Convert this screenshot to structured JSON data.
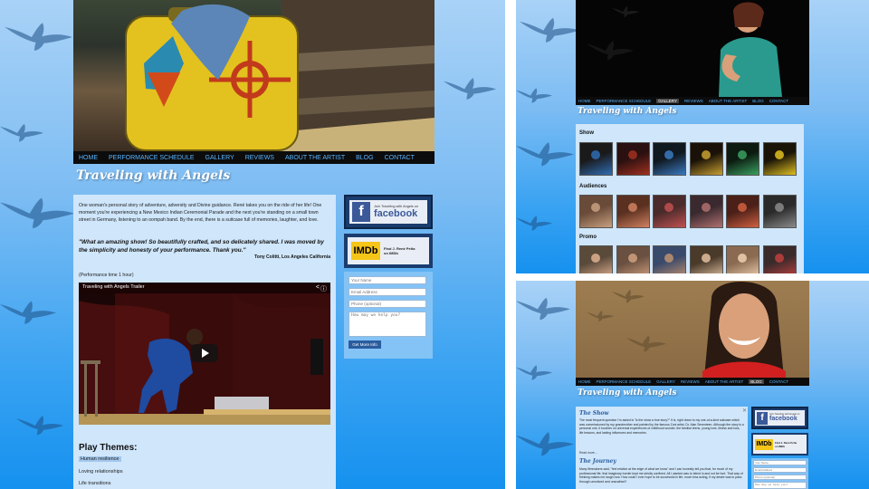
{
  "site": {
    "title": "Traveling with Angels"
  },
  "nav": [
    "HOME",
    "PERFORMANCE SCHEDULE",
    "GALLERY",
    "REVIEWS",
    "ABOUT THE ARTIST",
    "BLOG",
    "CONTACT"
  ],
  "home": {
    "intro": "One woman's personal story of adventure, adversity and Divine guidance. René takes you on the ride of her life! One moment you're experiencing a New Mexico Indian Ceremonial Parade and the next you're standing on a small town street in Germany, listening to an oompah band. By the end, there is a suitcase full of memories, laughter, and love.",
    "quote": "\"What an amazing show! So beautifully crafted, and so delicately shared. I was moved by the simplicity and honesty of your performance. Thank you.\"",
    "quote_author": "Tony Colitti, Los Angeles California",
    "performance_time": "(Performance time 1 hour)",
    "video_title": "Traveling with Angels Trailer",
    "themes_heading": "Play Themes:",
    "themes": [
      "Human resilience",
      "Loving relationships",
      "Life transitions"
    ]
  },
  "sidebar": {
    "facebook_small": "Join Traveling with Angels on",
    "facebook_big": "facebook",
    "imdb_logo": "IMDb",
    "imdb_line1": "Find J. René Peña",
    "imdb_line2": "on IMDb",
    "form": {
      "name_placeholder": "Your Name",
      "email_placeholder": "Email Address",
      "phone_placeholder": "Phone (optional)",
      "message_placeholder": "How may we help you?",
      "button": "Get More Info"
    }
  },
  "gallery": {
    "sections": [
      "Show",
      "Audiences",
      "Promo"
    ],
    "active_nav": "GALLERY"
  },
  "about": {
    "active_nav": "BLOG",
    "section1_title": "The Show",
    "section1_text": "The most frequent question I'm asked is \"is the show a true story?\" It is, right down to my one-of-a-kind suitcase which was commissioned by my grandmother and painted by the famous Zuni artist, Dr. Alan Seventeen. Although the story is a personal one, it touches on universal experiences of childhood wonder, the familiar teens, young love, illness and loss, life lessons, and lasting influences and memories.",
    "read_more": "Read more...",
    "section2_title": "The Journey",
    "section2_text": "Many filmmakers said, \"feel relative at the edge of what we know\" and I can honestly tell you that, for much of my professional life, that imaginary border kept me strictly confined. All I wanted was to blend in and not be hurt. That way of thinking makes me laugh now. How could I ever hope to be successful in life, much less acting, if my desire was to pass through unnoticed and unscathed?"
  },
  "colors": {
    "page_gradient_top": "#a9d2f7",
    "page_gradient_bottom": "#1591ef",
    "nav_bg": "#0c0c0c",
    "nav_text": "#59b4ff",
    "content_bg": "#cfe6fb",
    "button_bg": "#2a5c9e"
  }
}
